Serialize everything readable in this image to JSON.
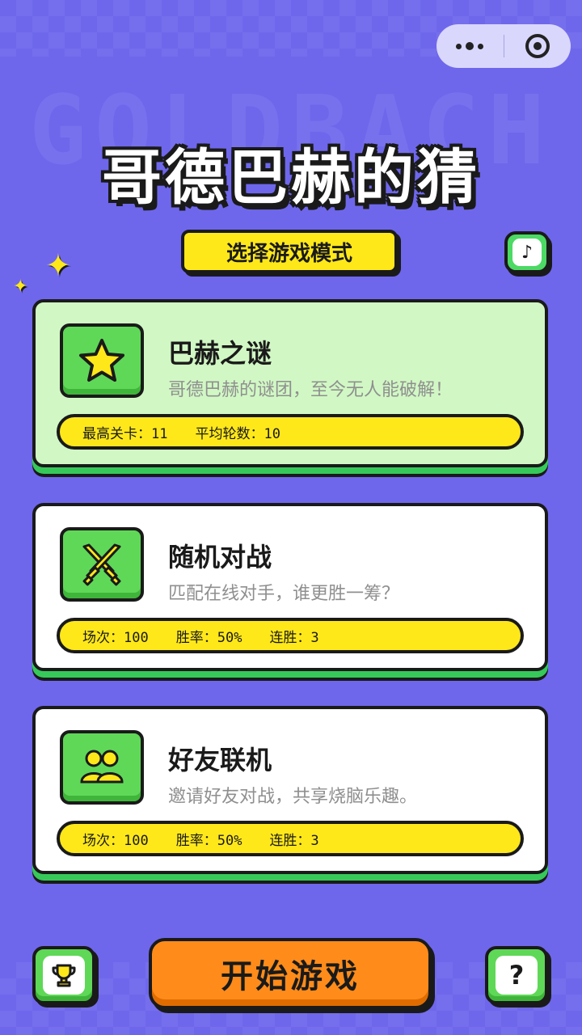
{
  "app": {
    "title": "哥德巴赫的猜",
    "background_word": "GOLDBACH",
    "mode_label": "选择游戏模式"
  },
  "capsule": {
    "more_icon": "more-dots-icon",
    "close_icon": "target-circle-icon"
  },
  "music_button": {
    "icon": "music-note-icon",
    "glyph": "♪"
  },
  "modes": [
    {
      "title": "巴赫之谜",
      "description": "哥德巴赫的谜团，至今无人能破解！",
      "icon": "star-icon",
      "selected": true,
      "stats": [
        "最高关卡：11",
        "平均轮数：10"
      ]
    },
    {
      "title": "随机对战",
      "description": "匹配在线对手，谁更胜一筹？",
      "icon": "crossed-swords-icon",
      "selected": false,
      "stats": [
        "场次：100",
        "胜率：50%",
        "连胜：3"
      ]
    },
    {
      "title": "好友联机",
      "description": "邀请好友对战，共享烧脑乐趣。",
      "icon": "friends-icon",
      "selected": false,
      "stats": [
        "场次：100",
        "胜率：50%",
        "连胜：3"
      ]
    }
  ],
  "bottom": {
    "trophy_icon": "trophy-icon",
    "start_label": "开始游戏",
    "help_icon": "help-icon",
    "help_glyph": "?"
  },
  "colors": {
    "background": "#6e67ec",
    "accent_yellow": "#ffe81a",
    "accent_green": "#5fd857",
    "selected_card": "#d1f8c4",
    "start_orange": "#ff8c1a"
  }
}
